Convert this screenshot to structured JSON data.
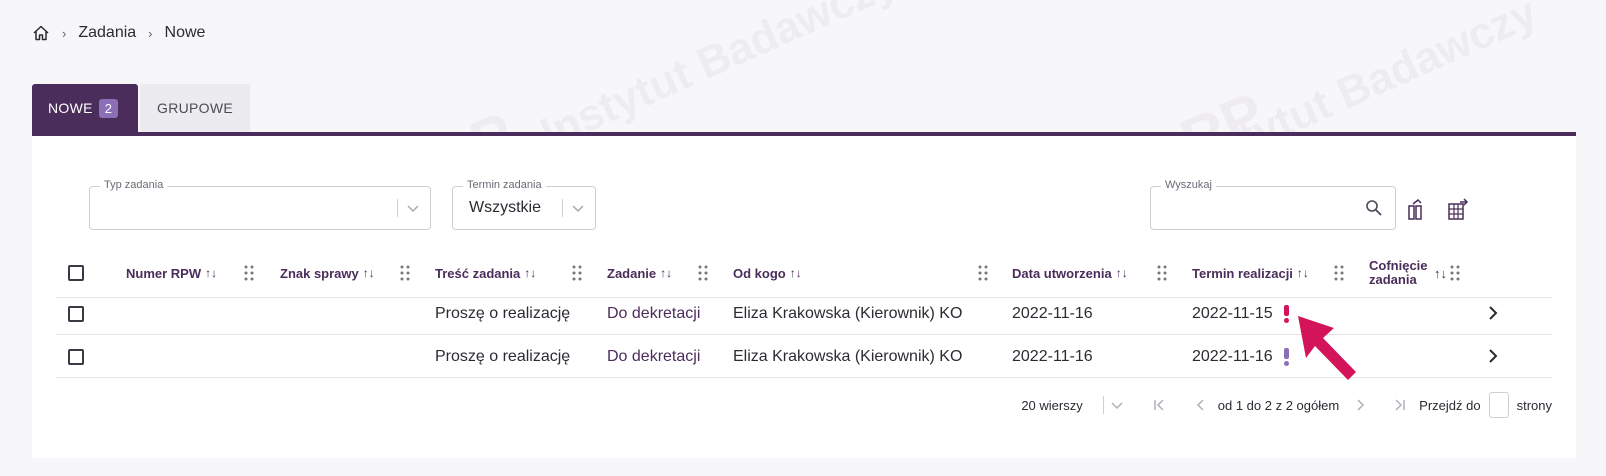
{
  "breadcrumb": {
    "items": [
      "Zadania",
      "Nowe"
    ]
  },
  "tabs": [
    {
      "label": "NOWE",
      "badge": "2",
      "active": true
    },
    {
      "label": "GRUPOWE",
      "active": false
    }
  ],
  "filters": {
    "task_type": {
      "label": "Typ zadania",
      "value": ""
    },
    "task_term": {
      "label": "Termin zadania",
      "value": "Wszystkie"
    },
    "search": {
      "label": "Wyszukaj",
      "value": ""
    }
  },
  "table": {
    "columns": [
      "Numer RPW",
      "Znak sprawy",
      "Treść zadania",
      "Zadanie",
      "Od kogo",
      "Data utworzenia",
      "Termin realizacji",
      "Cofnięcie zadania"
    ],
    "rows": [
      {
        "numer_rpw": "",
        "znak_sprawy": "",
        "tresc": "Proszę o realizację",
        "zadanie": "Do dekretacji",
        "od_kogo": "Eliza Krakowska (Kierownik) KO",
        "data_utworzenia": "2022-11-16",
        "termin": "2022-11-15",
        "priority_color": "#d4145a"
      },
      {
        "numer_rpw": "",
        "znak_sprawy": "",
        "tresc": "Proszę o realizację",
        "zadanie": "Do dekretacji",
        "od_kogo": "Eliza Krakowska (Kierownik) KO",
        "data_utworzenia": "2022-11-16",
        "termin": "2022-11-16",
        "priority_color": "#8b70b8"
      }
    ]
  },
  "pagination": {
    "rows_per_page": "20 wierszy",
    "summary": "od 1 do 2 z 2 ogółem",
    "goto_label": "Przejdź do",
    "pages_label": "strony"
  },
  "colors": {
    "accent": "#4a2d5a",
    "badge": "#8b70b8",
    "overdue": "#d4145a",
    "pointer": "#d4145a"
  },
  "watermark": {
    "line1": "NASK – Państwowy Instytut Badawczy",
    "logo": "EZD RP"
  }
}
